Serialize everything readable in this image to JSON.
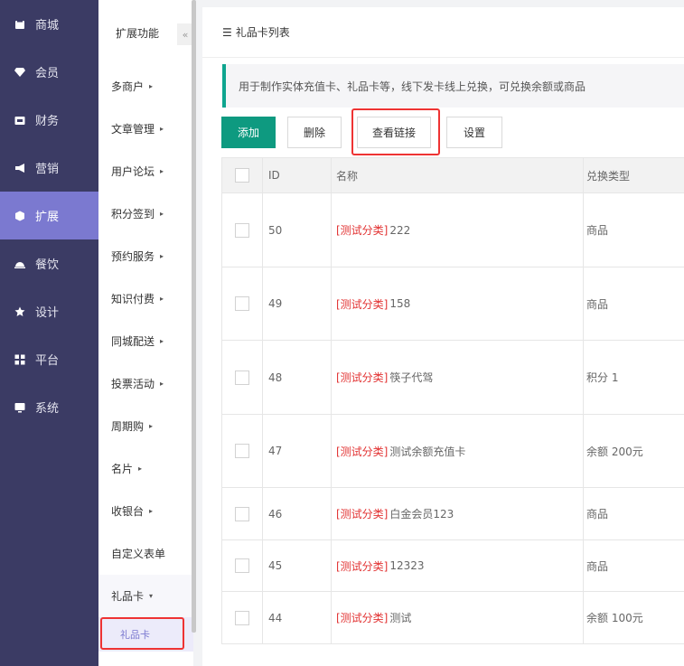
{
  "nav": {
    "items": [
      {
        "label": "商城",
        "icon": "store-icon"
      },
      {
        "label": "会员",
        "icon": "diamond-icon"
      },
      {
        "label": "财务",
        "icon": "wallet-icon"
      },
      {
        "label": "营销",
        "icon": "megaphone-icon"
      },
      {
        "label": "扩展",
        "icon": "cube-icon",
        "active": true
      },
      {
        "label": "餐饮",
        "icon": "dish-icon"
      },
      {
        "label": "设计",
        "icon": "puzzle-icon"
      },
      {
        "label": "平台",
        "icon": "grid-icon"
      },
      {
        "label": "系统",
        "icon": "monitor-icon"
      }
    ]
  },
  "submenu": {
    "title": "扩展功能",
    "collapse_icon": "«",
    "items": [
      {
        "label": "多商户",
        "arrow": "▸"
      },
      {
        "label": "文章管理",
        "arrow": "▸"
      },
      {
        "label": "用户论坛",
        "arrow": "▸"
      },
      {
        "label": "积分签到",
        "arrow": "▸"
      },
      {
        "label": "预约服务",
        "arrow": "▸"
      },
      {
        "label": "知识付费",
        "arrow": "▸"
      },
      {
        "label": "同城配送",
        "arrow": "▸"
      },
      {
        "label": "投票活动",
        "arrow": "▸"
      },
      {
        "label": "周期购",
        "arrow": "▸"
      },
      {
        "label": "名片",
        "arrow": "▸"
      },
      {
        "label": "收银台",
        "arrow": "▸"
      },
      {
        "label": "自定义表单",
        "arrow": ""
      },
      {
        "label": "礼品卡",
        "arrow": "▾"
      }
    ],
    "active_child": "礼品卡"
  },
  "page": {
    "title_icon": "☰",
    "title": "礼品卡列表",
    "notice": "用于制作实体充值卡、礼品卡等，线下发卡线上兑换，可兑换余额或商品"
  },
  "toolbar": {
    "add": "添加",
    "delete": "删除",
    "view_link": "查看链接",
    "settings": "设置"
  },
  "table": {
    "headers": {
      "id": "ID",
      "name": "名称",
      "type": "兑换类型"
    },
    "rows": [
      {
        "id": "50",
        "tag": "[测试分类]",
        "name": "222",
        "type": "商品"
      },
      {
        "id": "49",
        "tag": "[测试分类]",
        "name": "158",
        "type": "商品"
      },
      {
        "id": "48",
        "tag": "[测试分类]",
        "name": "筷子代驾",
        "type": "积分 1"
      },
      {
        "id": "47",
        "tag": "[测试分类]",
        "name": "测试余额充值卡",
        "type": "余额 200元"
      },
      {
        "id": "46",
        "tag": "[测试分类]",
        "name": "白金会员123",
        "type": "商品"
      },
      {
        "id": "45",
        "tag": "[测试分类]",
        "name": "12323",
        "type": "商品"
      },
      {
        "id": "44",
        "tag": "[测试分类]",
        "name": "测试",
        "type": "余额 100元"
      }
    ]
  },
  "colors": {
    "nav_bg": "#3b3b64",
    "nav_active": "#7b79d0",
    "primary": "#0e9a80",
    "highlight": "#e33333",
    "tag": "#e23333"
  }
}
